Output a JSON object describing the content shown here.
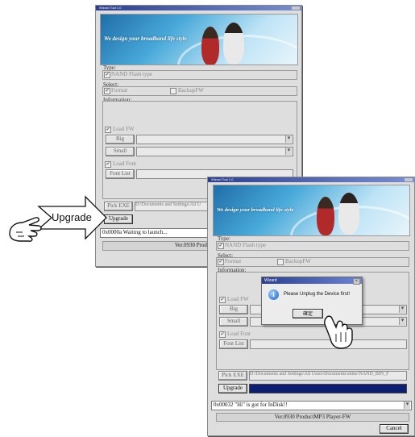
{
  "window1": {
    "title": "Wizard Tool 1.0",
    "banner_text": "We design your broadband life style",
    "type_label": "Type:",
    "type_value": "NAND Flash type",
    "select_label": "Select:",
    "format_label": "Format",
    "backup_label": "BackupFW",
    "info_label": "Information:",
    "load_fw_label": "Load FW",
    "big_button": "Big",
    "small_button": "Small",
    "load_font_label": "Load Font",
    "font_list_button": "Font List",
    "pick_exe_button": "Pick EXE",
    "path_value": "D:\\Documents and Settings\\All U",
    "upgrade_button": "Upgrade",
    "status_text": "0x0000a Waiting to launch...",
    "version_text": "Ver.0930  ProductMP3"
  },
  "window2": {
    "title": "Wizard Tool 1.0",
    "banner_text": "We design your broadband life style",
    "type_label": "Type:",
    "type_value": "NAND Flash type",
    "select_label": "Select:",
    "format_label": "Format",
    "backup_label": "BackupFW",
    "info_label": "Information:",
    "load_fw_label": "Load FW",
    "big_button": "Big",
    "small_button": "Small",
    "load_font_label": "Load Font",
    "font_list_button": "Font List",
    "pick_exe_button": "Pick EXE",
    "path_value": "D:\\Documents and Settings\\All Users\\Documents\\shine\\NAND_BIN_F",
    "upgrade_button": "Upgrade",
    "status_text": "0x00032 \"Hi\" is got for InDisk!!",
    "version_text": "Ver.0930  ProductMP3 Player-FW",
    "cancel_button": "Cancel"
  },
  "dialog": {
    "title": "Wizard",
    "message": "Please Unplug the Device first!",
    "ok_button": "確定",
    "close": "×"
  },
  "callout": {
    "label": "Upgrade"
  },
  "colors": {
    "progress": "#0c1f73",
    "titlebar": "#2b3f8f",
    "window_bg": "#dedede"
  }
}
